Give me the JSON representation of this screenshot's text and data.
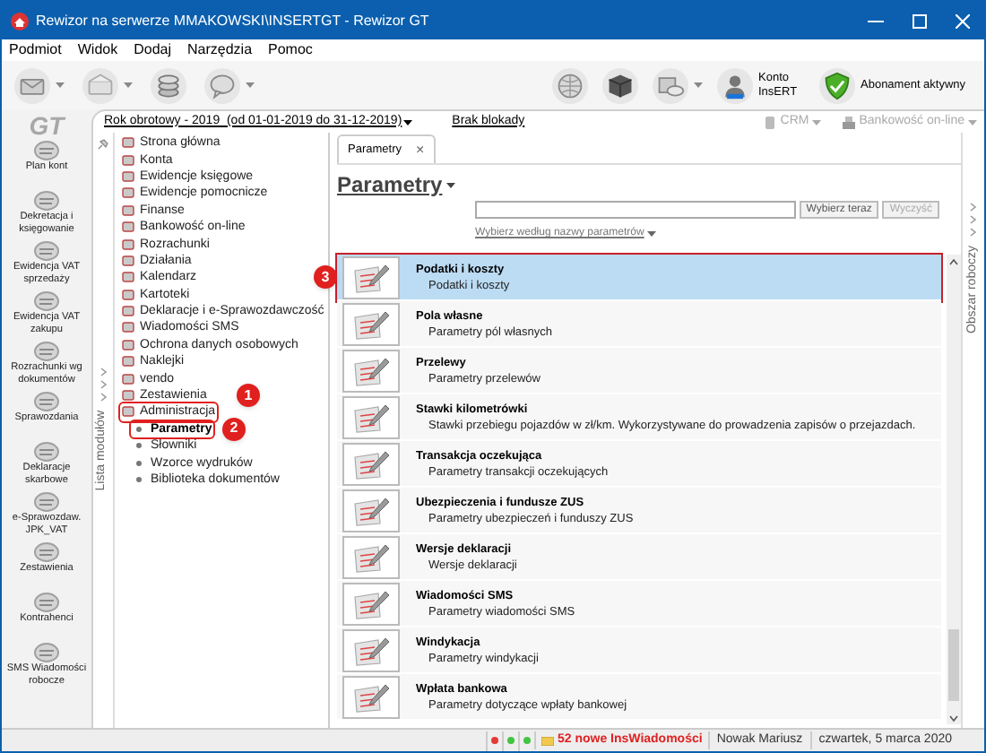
{
  "window": {
    "title": "Rewizor na serwerze MMAKOWSKI\\INSERTGT - Rewizor GT"
  },
  "menu": [
    "Podmiot",
    "Widok",
    "Dodaj",
    "Narzędzia",
    "Pomoc"
  ],
  "toolbar": {
    "left": [
      {
        "kind": "mail",
        "dropdown": true
      },
      {
        "kind": "envelope",
        "dropdown": true
      },
      {
        "kind": "coins",
        "dropdown": false
      },
      {
        "kind": "chat",
        "dropdown": true
      }
    ],
    "right": [
      {
        "kind": "globe"
      },
      {
        "kind": "box"
      },
      {
        "kind": "cloud",
        "dropdown": true
      },
      {
        "kind": "account",
        "label": "Konto InsERT"
      },
      {
        "kind": "shield",
        "label": "Abonament aktywny"
      }
    ]
  },
  "info_bar": {
    "logo": "GT",
    "fiscal_year": "Rok obrotowy - 2019  (od 01-01-2019 do 31-12-2019)",
    "lock_status": "Brak blokady",
    "right": [
      {
        "label": "CRM",
        "disabled": true
      },
      {
        "label": "Bankowość on-line",
        "disabled": true
      }
    ]
  },
  "modules": [
    "Plan kont",
    "Dekretacja i księgowanie",
    "Ewidencja VAT sprzedaży",
    "Ewidencja VAT zakupu",
    "Rozrachunki wg dokumentów",
    "Sprawozdania",
    "Deklaracje skarbowe",
    "e-Sprawozdaw. JPK_VAT",
    "Zestawienia",
    "Kontrahenci",
    "SMS Wiadomości robocze"
  ],
  "side_labels": {
    "left": "Lista modułów",
    "right": "Obszar roboczy"
  },
  "tree": [
    {
      "label": "Strona główna",
      "selected": false
    },
    {
      "label": "Konta",
      "selected": false
    },
    {
      "label": "Ewidencje księgowe",
      "selected": false
    },
    {
      "label": "Ewidencje pomocnicze",
      "selected": false
    },
    {
      "label": "Finanse",
      "selected": false
    },
    {
      "label": "Bankowość on-line",
      "selected": false
    },
    {
      "label": "Rozrachunki",
      "selected": false
    },
    {
      "label": "Działania",
      "selected": false
    },
    {
      "label": "Kalendarz",
      "selected": false
    },
    {
      "label": "Kartoteki",
      "selected": false
    },
    {
      "label": "Deklaracje i e-Sprawozdawczość",
      "selected": false
    },
    {
      "label": "Wiadomości SMS",
      "selected": false
    },
    {
      "label": "Ochrona danych osobowych",
      "selected": false
    },
    {
      "label": "Naklejki",
      "selected": false
    },
    {
      "label": "vendo",
      "selected": false
    },
    {
      "label": "Zestawienia",
      "selected": false
    },
    {
      "label": "Administracja",
      "selected": false,
      "expanded": true,
      "highlighted": true,
      "callout": "1",
      "children": [
        {
          "label": "Parametry",
          "selected": true,
          "highlighted": true,
          "callout": "2"
        },
        {
          "label": "Słowniki",
          "selected": false
        },
        {
          "label": "Wzorce wydruków",
          "selected": false
        },
        {
          "label": "Biblioteka dokumentów",
          "selected": false
        }
      ]
    }
  ],
  "tabs": [
    {
      "label": "Parametry",
      "selected": true,
      "close": "×"
    }
  ],
  "heading": "Parametry",
  "search": {
    "buttons": [
      {
        "label": "Wybierz teraz",
        "disabled": false
      },
      {
        "label": "Wyczyść",
        "disabled": true
      }
    ],
    "filter_link": "Wybierz według nazwy parametrów"
  },
  "parameters": [
    {
      "title": "Podatki i koszty",
      "description": "Podatki i koszty",
      "selected": true,
      "highlighted": true,
      "callout": "3"
    },
    {
      "title": "Pola własne",
      "description": "Parametry pól własnych",
      "selected": false
    },
    {
      "title": "Przelewy",
      "description": "Parametry przelewów",
      "selected": false
    },
    {
      "title": "Stawki kilometrówki",
      "description": "Stawki przebiegu pojazdów w zł/km. Wykorzystywane do prowadzenia zapisów o przejazdach.",
      "selected": false
    },
    {
      "title": "Transakcja oczekująca",
      "description": "Parametry transakcji oczekujących",
      "selected": false
    },
    {
      "title": "Ubezpieczenia i fundusze ZUS",
      "description": "Parametry ubezpieczeń i funduszy ZUS",
      "selected": false
    },
    {
      "title": "Wersje deklaracji",
      "description": "Wersje deklaracji",
      "selected": false
    },
    {
      "title": "Wiadomości SMS",
      "description": "Parametry wiadomości SMS",
      "selected": false
    },
    {
      "title": "Windykacja",
      "description": "Parametry windykacji",
      "selected": false
    },
    {
      "title": "Wpłata bankowa",
      "description": "Parametry dotyczące wpłaty bankowej",
      "selected": false
    }
  ],
  "status_bar": {
    "indicators": [
      {
        "color": "#e53935"
      },
      {
        "color": "#43c443"
      },
      {
        "color": "#43c443"
      }
    ],
    "messages": "52 nowe InsWiadomości",
    "user": "Nowak Mariusz",
    "date": "czwartek, 5 marca 2020"
  }
}
